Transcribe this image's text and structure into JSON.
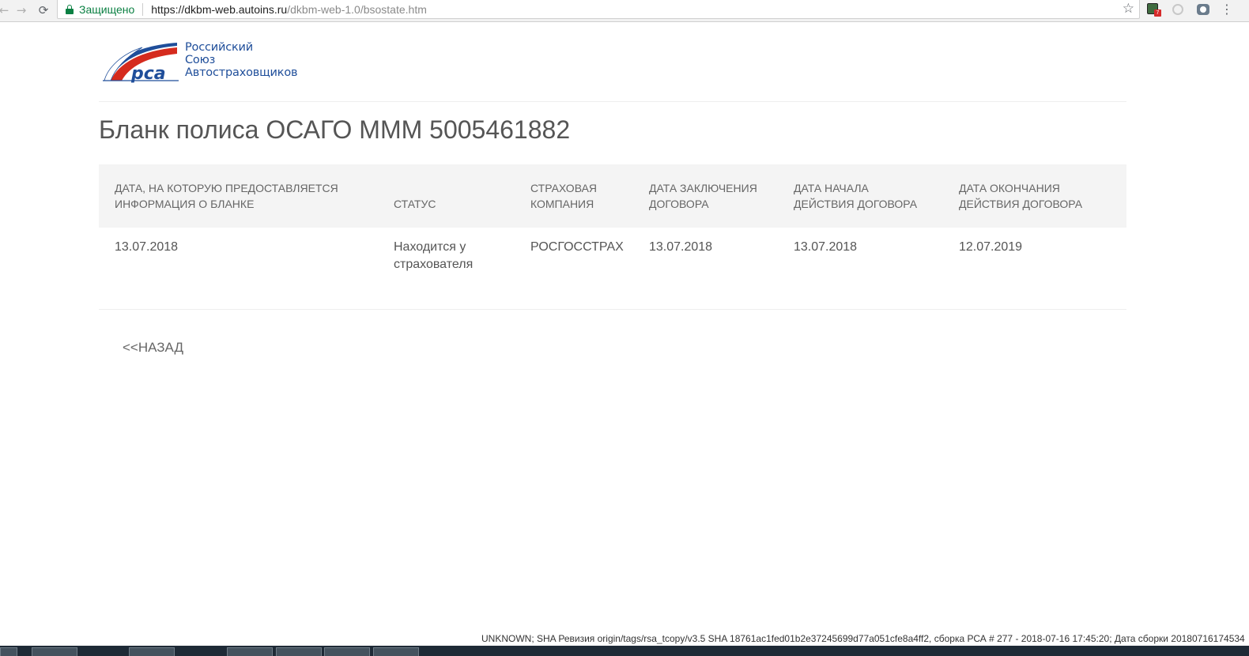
{
  "browser": {
    "secure_label": "Защищено",
    "url_host": "https://dkbm-web.autoins.ru",
    "url_path": "/dkbm-web-1.0/bsostate.htm",
    "extension_badge": "7"
  },
  "logo": {
    "abbr": "рса",
    "line1": "Российский",
    "line2": "Союз",
    "line3": "Автостраховщиков"
  },
  "page": {
    "title": "Бланк полиса ОСАГО МММ 5005461882"
  },
  "table": {
    "headers": [
      {
        "line1": "ДАТА, НА КОТОРУЮ ПРЕДОСТАВЛЯЕТСЯ",
        "line2": "ИНФОРМАЦИЯ О БЛАНКЕ"
      },
      {
        "line1": "",
        "line2": "СТАТУС"
      },
      {
        "line1": "СТРАХОВАЯ",
        "line2": "КОМПАНИЯ"
      },
      {
        "line1": "ДАТА ЗАКЛЮЧЕНИЯ",
        "line2": "ДОГОВОРА"
      },
      {
        "line1": "ДАТА НАЧАЛА",
        "line2": "ДЕЙСТВИЯ ДОГОВОРА"
      },
      {
        "line1": "ДАТА ОКОНЧАНИЯ",
        "line2": "ДЕЙСТВИЯ ДОГОВОРА"
      }
    ],
    "row": {
      "info_date": "13.07.2018",
      "status_line1": "Находится у",
      "status_line2": "страхователя",
      "company": "РОСГОССТРАХ",
      "conclusion_date": "13.07.2018",
      "start_date": "13.07.2018",
      "end_date": "12.07.2019"
    }
  },
  "nav": {
    "back_label": "<<НАЗАД"
  },
  "footer": {
    "build_info": "UNKNOWN; SHA Ревизия origin/tags/rsa_tcopy/v3.5 SHA 18761ac1fed01b2e37245699d77a051cfe8a4ff2, сборка РСА # 277 - 2018-07-16 17:45:20; Дата сборки 20180716174534"
  },
  "colors": {
    "secure_green": "#0b8043",
    "logo_blue": "#1f4e9a",
    "logo_red": "#d52b1e",
    "header_bg": "#f4f4f4",
    "text": "#555555"
  }
}
